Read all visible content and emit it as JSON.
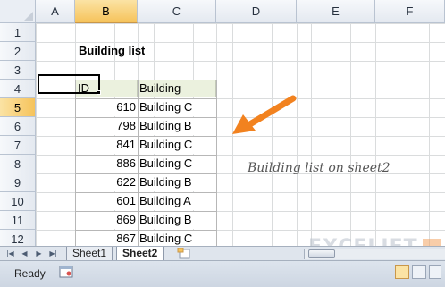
{
  "grid": {
    "columns": [
      "A",
      "B",
      "C",
      "D",
      "E",
      "F"
    ],
    "selected_column": "B",
    "rows": [
      "1",
      "2",
      "3",
      "4",
      "5",
      "6",
      "7",
      "8",
      "9",
      "10",
      "11",
      "12"
    ],
    "selected_row": "5"
  },
  "sheet": {
    "title": "Building list",
    "table_headers": {
      "id": "ID",
      "building": "Building"
    },
    "records": [
      {
        "id": "610",
        "building": "Building C"
      },
      {
        "id": "798",
        "building": "Building B"
      },
      {
        "id": "841",
        "building": "Building C"
      },
      {
        "id": "886",
        "building": "Building C"
      },
      {
        "id": "622",
        "building": "Building B"
      },
      {
        "id": "601",
        "building": "Building A"
      },
      {
        "id": "869",
        "building": "Building B"
      },
      {
        "id": "867",
        "building": "Building C"
      }
    ],
    "annotation": "Building list on sheet2"
  },
  "tabs": [
    "Sheet1",
    "Sheet2"
  ],
  "active_tab": "Sheet2",
  "status": {
    "text": "Ready"
  },
  "logo": {
    "text": "EXCELJET"
  },
  "colors": {
    "arrow": "#f2821f",
    "selected_header": "#f6c35b",
    "table_header_fill": "#ebf1de"
  }
}
